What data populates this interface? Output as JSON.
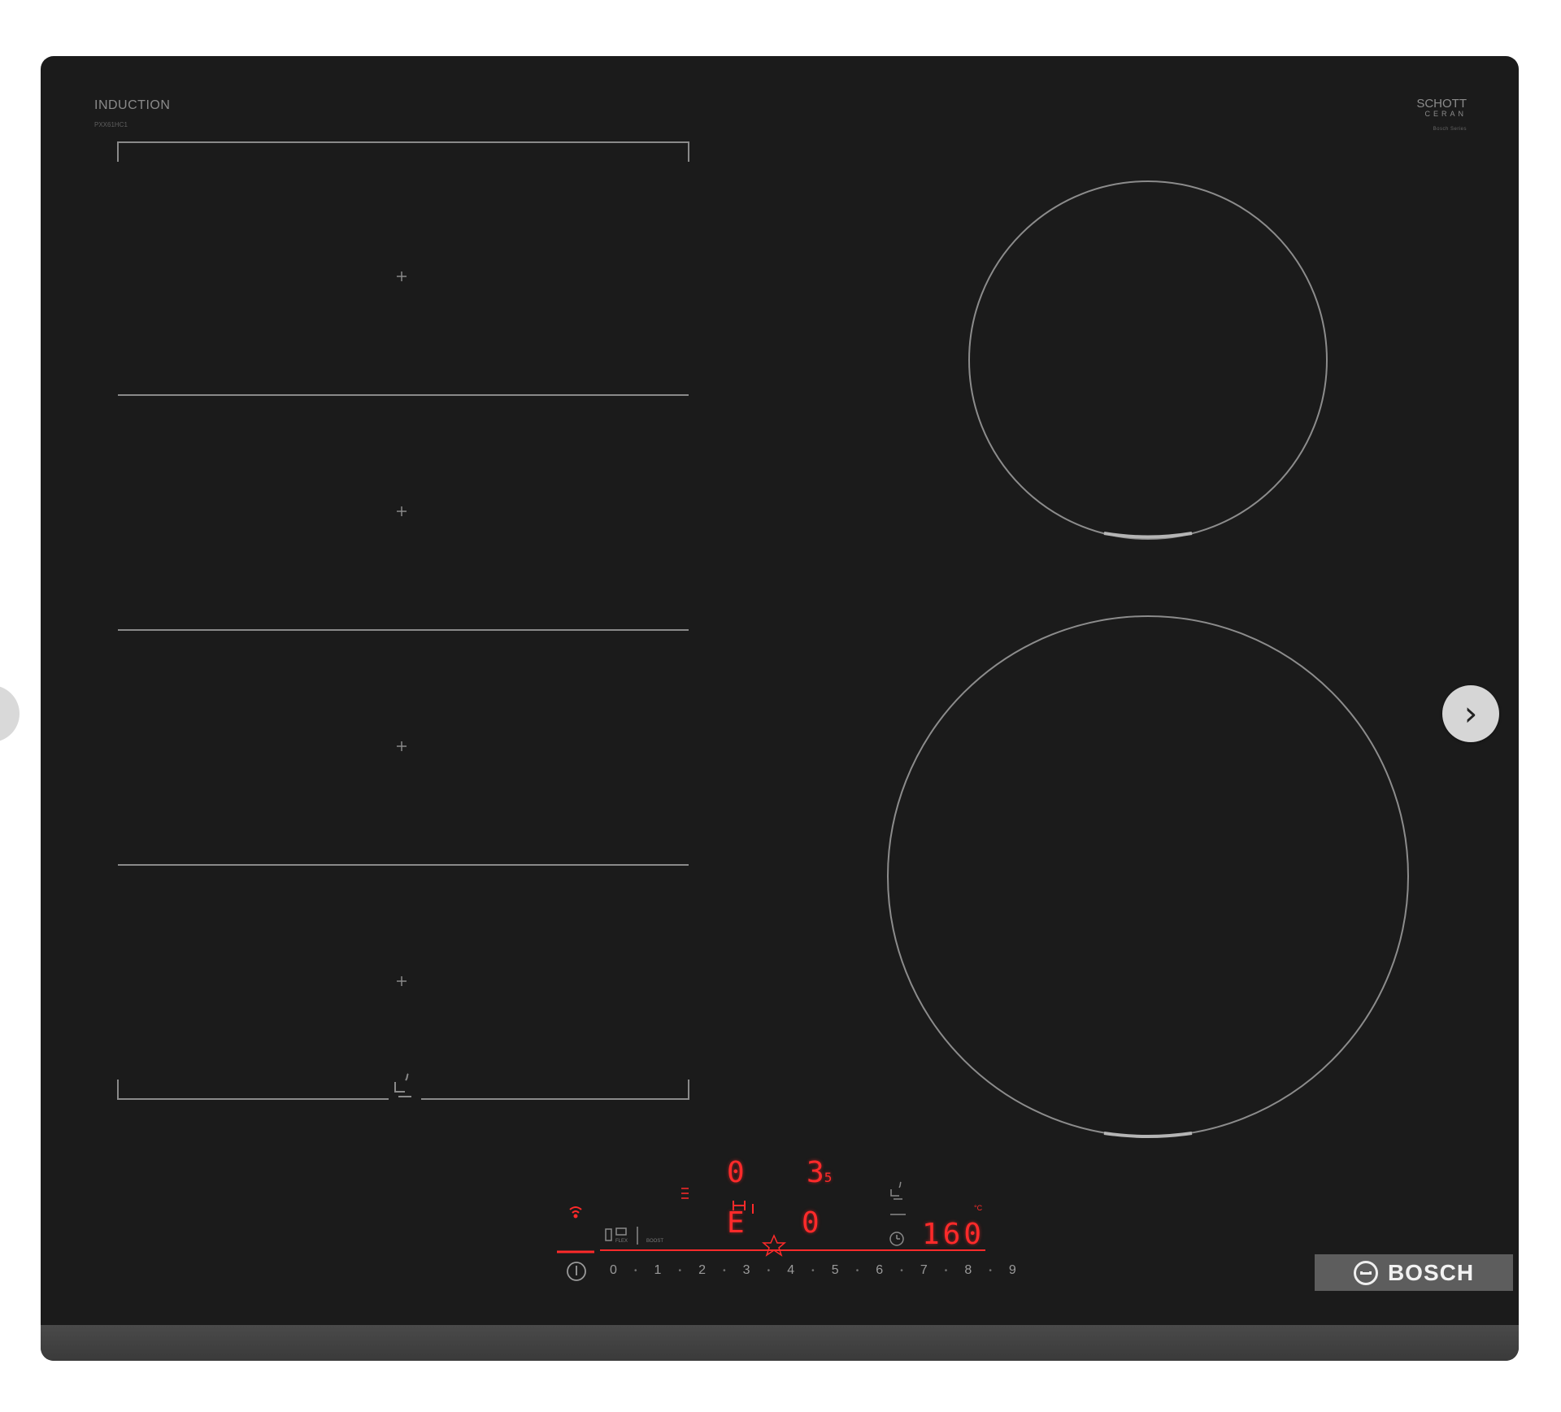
{
  "cooktop": {
    "brand_top": "INDUCTION",
    "model": "PXX61HC1",
    "glass_brand": "SCHOTT",
    "glass_sub": "CERAN",
    "glass_tiny": "Bosch Series",
    "badge": "BOSCH",
    "display": {
      "top_left": "0",
      "top_right": "3",
      "top_right_sub": "5",
      "mid_left": "E",
      "mid_right": "0",
      "temp": "160",
      "temp_unit": "°C"
    },
    "scale": [
      "0",
      "1",
      "2",
      "3",
      "4",
      "5",
      "6",
      "7",
      "8",
      "9"
    ],
    "labels": {
      "flex": "FLEX",
      "boost": "BOOST"
    }
  },
  "nav": {
    "next": "›"
  },
  "colors": {
    "surface": "#1b1b1b",
    "display_red": "#ff2a2a",
    "line_gray": "#8a8a8a"
  }
}
